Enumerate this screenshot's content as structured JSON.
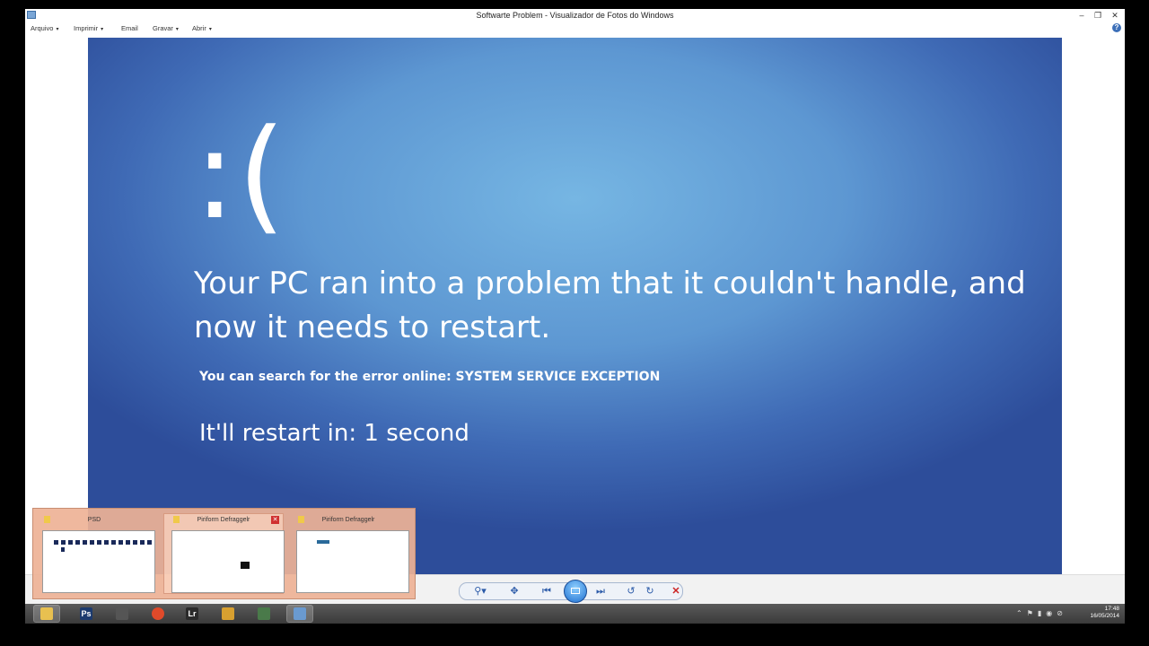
{
  "window": {
    "title": "Softwarte Problem - Visualizador de Fotos do Windows",
    "controls": {
      "minimize": "–",
      "restore": "❐",
      "close": "✕"
    }
  },
  "menu": {
    "items": [
      {
        "label": "Arquivo",
        "arrow": "▾"
      },
      {
        "label": "Imprimir",
        "arrow": "▾"
      },
      {
        "label": "Email",
        "arrow": ""
      },
      {
        "label": "Gravar",
        "arrow": "▾"
      },
      {
        "label": "Abrir",
        "arrow": "▾"
      }
    ],
    "help": "?"
  },
  "photo": {
    "emoticon": ":(",
    "message": "Your PC ran into a problem that it couldn't handle, and now it needs to restart.",
    "error_line": "You can search for the error online: SYSTEM SERVICE EXCEPTION",
    "restart_line": "It'll restart in: 1 second"
  },
  "viewer_controls": {
    "zoom": "⚲▾",
    "fit": "✥",
    "previous": "⏮",
    "next": "⏭",
    "rotate_ccw": "↺",
    "rotate_cw": "↻",
    "delete": "✕"
  },
  "thumbnails": [
    {
      "title": "PSD"
    },
    {
      "title": "Piriform Defraggelr",
      "close": "✕"
    },
    {
      "title": "Piriform Defraggelr"
    }
  ],
  "taskbar": {
    "apps": [
      {
        "name": "explorer",
        "glyph": "",
        "color": "#e8c050"
      },
      {
        "name": "photoshop",
        "glyph": "Ps",
        "color": "#1c3a6e"
      },
      {
        "name": "app-dark",
        "glyph": "",
        "color": "#555"
      },
      {
        "name": "chrome",
        "glyph": "",
        "color": "#e04a2a"
      },
      {
        "name": "lightroom",
        "glyph": "Lr",
        "color": "#2a2a2a"
      },
      {
        "name": "app-colorful",
        "glyph": "",
        "color": "#d8a030"
      },
      {
        "name": "app-tool",
        "glyph": "",
        "color": "#4a7a4a"
      },
      {
        "name": "photo-viewer",
        "glyph": "",
        "color": "#6a9ad0"
      }
    ],
    "clock": {
      "time": "17:48",
      "date": "16/05/2014"
    }
  }
}
